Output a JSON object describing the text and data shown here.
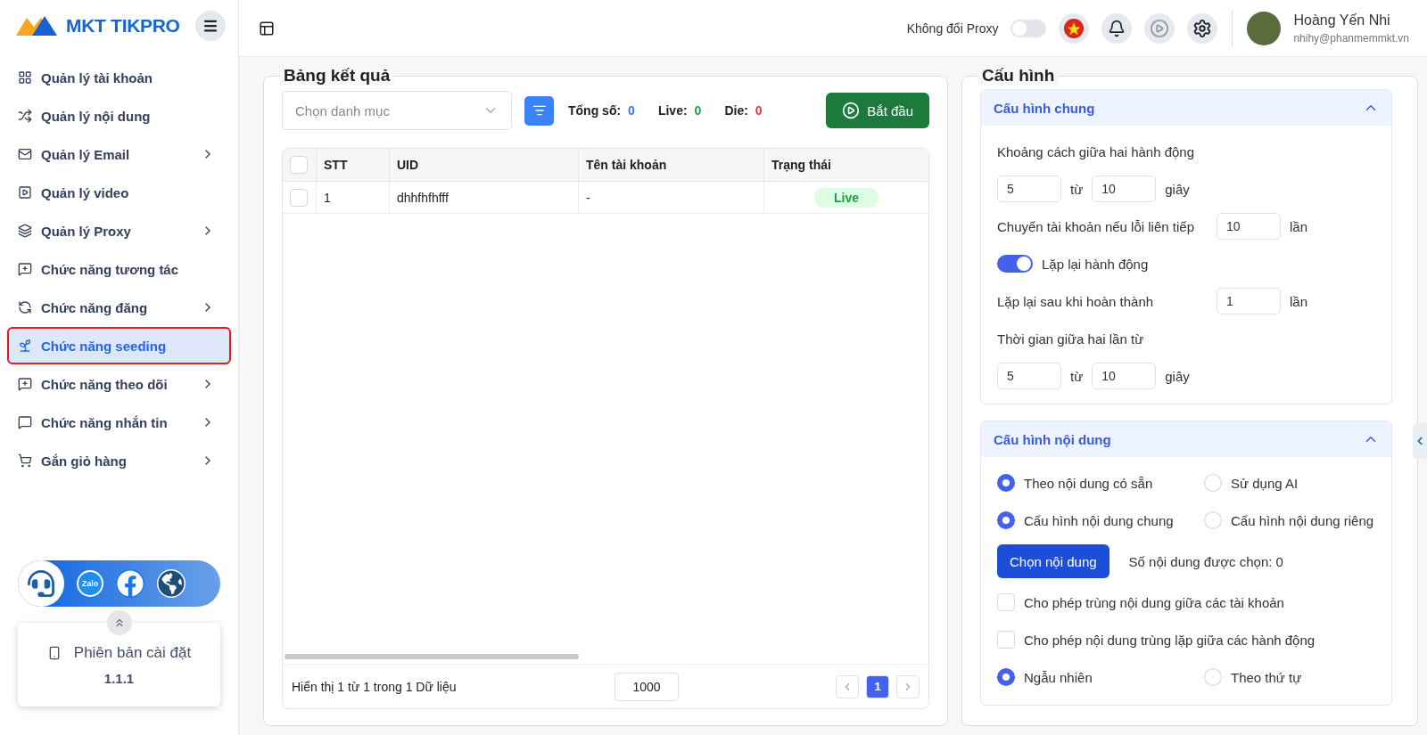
{
  "logo": {
    "text": "MKT TIKPRO"
  },
  "sidebar": {
    "items": [
      {
        "label": "Quản lý tài khoản",
        "has_children": false,
        "selected": false
      },
      {
        "label": "Quản lý nội dung",
        "has_children": false,
        "selected": false
      },
      {
        "label": "Quản lý Email",
        "has_children": true,
        "selected": false
      },
      {
        "label": "Quản lý video",
        "has_children": false,
        "selected": false
      },
      {
        "label": "Quản lý Proxy",
        "has_children": true,
        "selected": false
      },
      {
        "label": "Chức năng tương tác",
        "has_children": false,
        "selected": false
      },
      {
        "label": "Chức năng đăng",
        "has_children": true,
        "selected": false
      },
      {
        "label": "Chức năng seeding",
        "has_children": false,
        "selected": true
      },
      {
        "label": "Chức năng theo dõi",
        "has_children": true,
        "selected": false
      },
      {
        "label": "Chức năng nhắn tin",
        "has_children": true,
        "selected": false
      },
      {
        "label": "Gắn giỏ hàng",
        "has_children": true,
        "selected": false
      }
    ]
  },
  "contact_bar": {
    "zalo_label": "Zalo"
  },
  "version_card": {
    "label": "Phiên bản cài đặt",
    "value": "1.1.1"
  },
  "header": {
    "proxy_toggle": {
      "label": "Không đổi Proxy",
      "on": false
    },
    "user": {
      "name": "Hoàng Yến Nhi",
      "email": "nhihy@phanmemmkt.vn"
    }
  },
  "results": {
    "title": "Bảng kết quả",
    "category_select": {
      "placeholder": "Chọn danh mục"
    },
    "stats": [
      {
        "label": "Tổng số:",
        "value": "0",
        "color": "#2f7bf0"
      },
      {
        "label": "Live:",
        "value": "0",
        "color": "#1e9e4a"
      },
      {
        "label": "Die:",
        "value": "0",
        "color": "#e53935"
      }
    ],
    "start_button": "Bắt đầu",
    "table": {
      "select_all_checked": false,
      "columns": [
        "STT",
        "UID",
        "Tên tài khoản",
        "Trạng thái"
      ],
      "rows": [
        {
          "checked": false,
          "cells": [
            "1",
            "dhhfhfhfff",
            "-"
          ],
          "status": "Live"
        }
      ]
    },
    "footer": {
      "summary": "Hiển thị 1 từ 1 trong 1 Dữ liệu",
      "page_size": "1000",
      "pages": [
        {
          "label": "1",
          "selected": true
        }
      ]
    }
  },
  "config": {
    "title": "Cấu hình",
    "sections": [
      {
        "title": "Cấu hình chung",
        "expanded": true,
        "rows": [
          {
            "kind": "label",
            "text": "Khoảng cách giữa hai hành động"
          },
          {
            "kind": "range",
            "from": "5",
            "sep": "từ",
            "to": "10",
            "unit": "giây"
          },
          {
            "kind": "number",
            "label": "Chuyển tài khoản nếu lỗi liên tiếp",
            "value": "10",
            "unit": "lần"
          },
          {
            "kind": "switch",
            "label": "Lặp lại hành động",
            "on": true
          },
          {
            "kind": "number",
            "label": "Lặp lại sau khi hoàn thành",
            "value": "1",
            "unit": "lần"
          },
          {
            "kind": "label",
            "text": "Thời gian giữa hai lần từ"
          },
          {
            "kind": "range",
            "from": "5",
            "sep": "từ",
            "to": "10",
            "unit": "giây"
          }
        ]
      },
      {
        "title": "Cấu hình nội dung",
        "expanded": true,
        "rows": [
          {
            "kind": "radio_pair",
            "options": [
              {
                "label": "Theo nội dung có sẵn",
                "selected": true
              },
              {
                "label": "Sử dụng AI",
                "selected": false
              }
            ]
          },
          {
            "kind": "radio_pair",
            "options": [
              {
                "label": "Cấu hình nội dung chung",
                "selected": true
              },
              {
                "label": "Cấu hình nội dung riêng",
                "selected": false
              }
            ]
          },
          {
            "kind": "action",
            "button": "Chọn nội dung",
            "note": "Số nội dung được chọn: 0"
          },
          {
            "kind": "checkbox",
            "label": "Cho phép trùng nội dung giữa các tài khoản",
            "checked": false
          },
          {
            "kind": "checkbox",
            "label": "Cho phép nội dung trùng lặp giữa các hành động",
            "checked": false
          },
          {
            "kind": "radio_pair",
            "options": [
              {
                "label": "Ngẫu nhiên",
                "selected": true
              },
              {
                "label": "Theo thứ tự",
                "selected": false
              }
            ]
          }
        ]
      }
    ]
  }
}
